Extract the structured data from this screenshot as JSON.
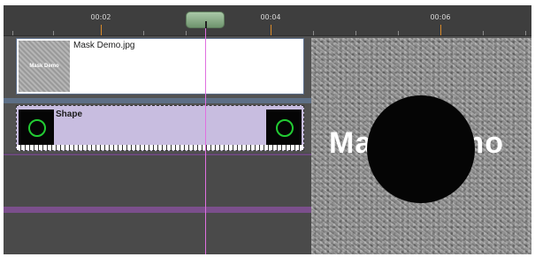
{
  "ruler": {
    "ticks": [
      "00:02",
      "00:04",
      "00:06"
    ]
  },
  "tracks": {
    "image_clip": {
      "title": "Mask Demo.jpg",
      "thumbnail_text": "Mask Demo"
    },
    "shape_clip": {
      "title": "Shape"
    }
  },
  "preview": {
    "overlay_text": "Mask Demo"
  },
  "colors": {
    "timeline_bg": "#4a4a4a",
    "ruler_bg": "#3e3e3e",
    "major_tick": "#d98a2b",
    "playhead_handle": "#8fb08d",
    "cursor_line": "#e070e0",
    "image_clip_fill": "#ffffff",
    "shape_clip_fill": "#c8bde0",
    "shape_ring": "#22cc33",
    "track_separator": "#5d6f86",
    "purple_row_line": "#7b4f8c"
  },
  "icons": {
    "shape_thumb_left": "green-circle-icon",
    "shape_thumb_right": "green-circle-icon"
  }
}
